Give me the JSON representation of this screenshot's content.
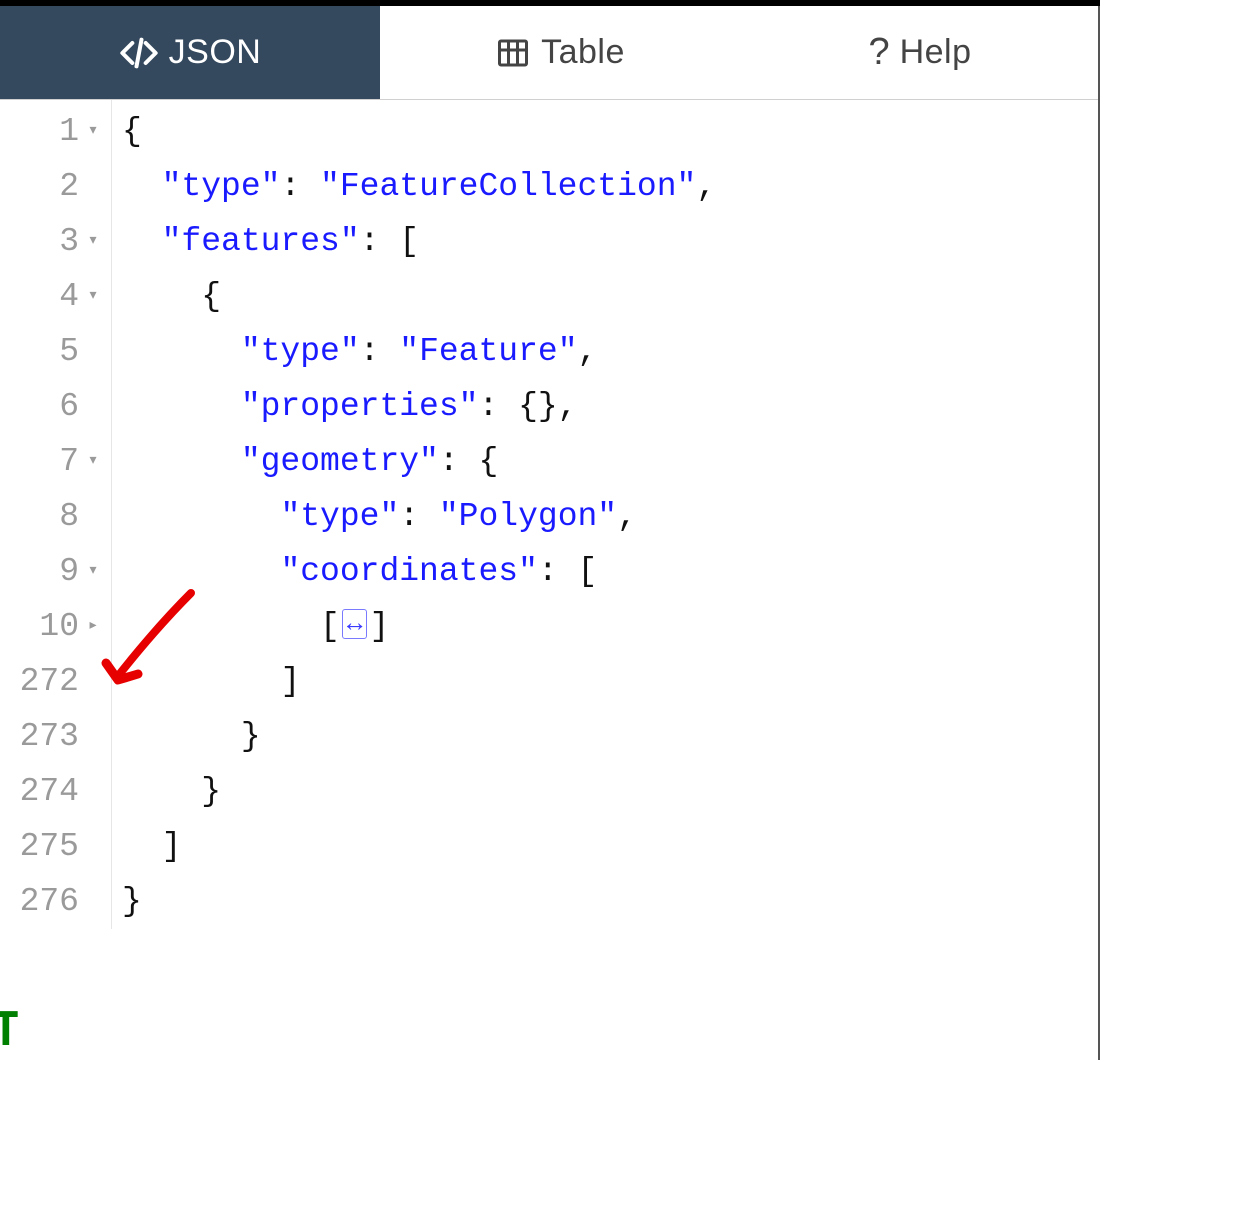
{
  "tabs": {
    "json": "JSON",
    "table": "Table",
    "help": "Help"
  },
  "gutter": [
    {
      "n": "1",
      "fold": "▾"
    },
    {
      "n": "2",
      "fold": ""
    },
    {
      "n": "3",
      "fold": "▾"
    },
    {
      "n": "4",
      "fold": "▾"
    },
    {
      "n": "5",
      "fold": ""
    },
    {
      "n": "6",
      "fold": ""
    },
    {
      "n": "7",
      "fold": "▾"
    },
    {
      "n": "8",
      "fold": ""
    },
    {
      "n": "9",
      "fold": "▾"
    },
    {
      "n": "10",
      "fold": "▸"
    },
    {
      "n": "272",
      "fold": ""
    },
    {
      "n": "273",
      "fold": ""
    },
    {
      "n": "274",
      "fold": ""
    },
    {
      "n": "275",
      "fold": ""
    },
    {
      "n": "276",
      "fold": ""
    }
  ],
  "code": {
    "l1": "{",
    "l2k": "\"type\"",
    "l2v": "\"FeatureCollection\"",
    "l3k": "\"features\"",
    "l5k": "\"type\"",
    "l5v": "\"Feature\"",
    "l6k": "\"properties\"",
    "l7k": "\"geometry\"",
    "l8k": "\"type\"",
    "l8v": "\"Polygon\"",
    "l9k": "\"coordinates\"",
    "collapsed": "↔",
    "l272": "]",
    "l273": "}",
    "l274": "}",
    "l275": "]",
    "l276": "}"
  }
}
